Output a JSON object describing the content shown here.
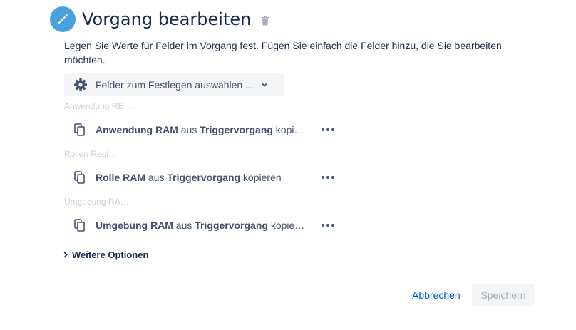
{
  "header": {
    "title": "Vorgang bearbeiten",
    "icon": "pencil-icon",
    "delete_icon": "trash-icon"
  },
  "description": "Legen Sie Werte für Felder im Vorgang fest. Fügen Sie einfach die Felder hinzu, die Sie bearbeiten möchten.",
  "field_select": {
    "label": "Felder zum Festlegen auswählen ...",
    "icon": "gear-icon"
  },
  "fields": [
    {
      "label": "Anwendung RE…",
      "value_lead": "Anwendung RAM",
      "value_mid": " aus ",
      "value_source": "Triggervorgang",
      "value_tail": " kopie…"
    },
    {
      "label": "Rollen Regi…",
      "value_lead": "Rolle RAM",
      "value_mid": " aus ",
      "value_source": "Triggervorgang",
      "value_tail": " kopieren"
    },
    {
      "label": "Umgebung RA…",
      "value_lead": "Umgebung RAM",
      "value_mid": " aus ",
      "value_source": "Triggervorgang",
      "value_tail": " kopie…"
    }
  ],
  "more_options": "Weitere Optionen",
  "actions": {
    "cancel": "Abbrechen",
    "save": "Speichern"
  },
  "colors": {
    "accent_icon_bg": "#4ba1e0",
    "link": "#0052cc",
    "text": "#172b4d",
    "disabled_text": "#a5adba"
  }
}
